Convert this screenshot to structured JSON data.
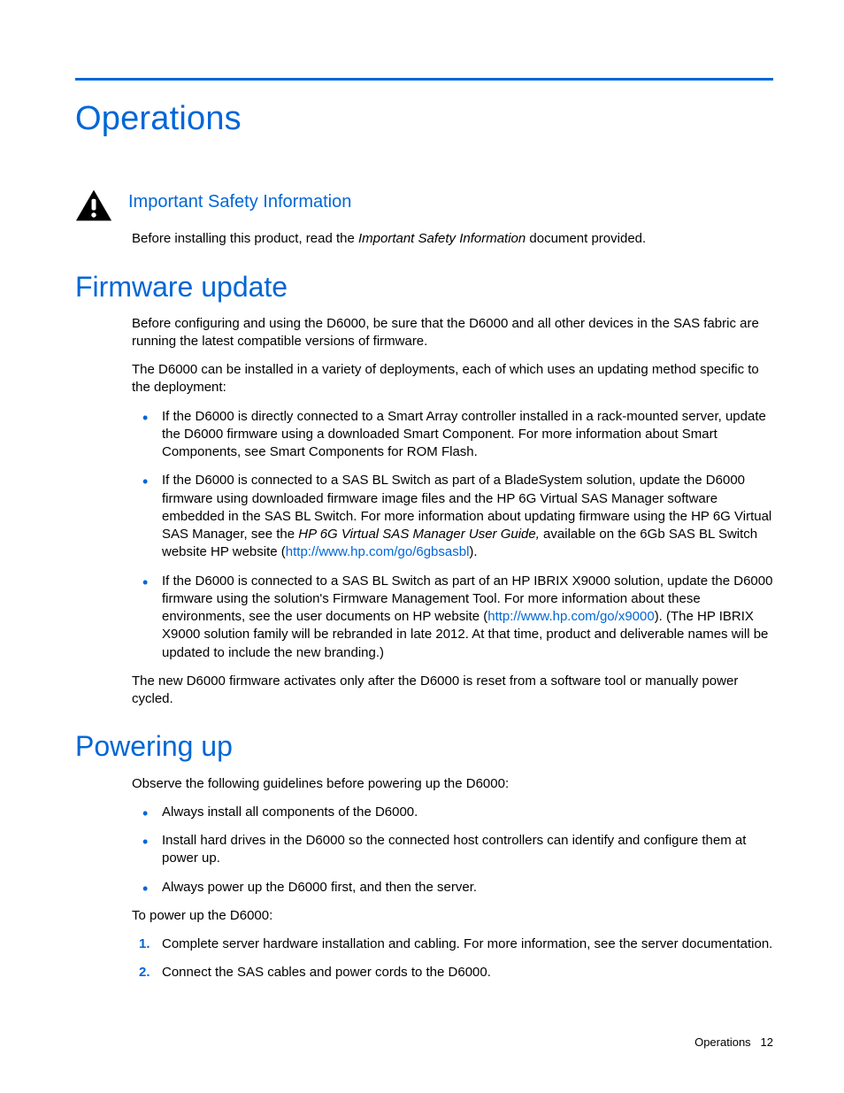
{
  "chapterTitle": "Operations",
  "safety": {
    "heading": "Important Safety Information",
    "p_before": "Before installing this product, read the ",
    "p_italic": "Important Safety Information",
    "p_after": " document provided."
  },
  "firmware": {
    "heading": "Firmware update",
    "p1": "Before configuring and using the D6000, be sure that the D6000 and all other devices in the SAS fabric are running the latest compatible versions of firmware.",
    "p2": "The D6000 can be installed in a variety of deployments, each of which uses an updating method specific to the deployment:",
    "b1": "If the D6000 is directly connected to a Smart Array controller installed in a rack-mounted server, update the D6000 firmware using a downloaded Smart Component. For more information about Smart Components, see Smart Components for ROM Flash.",
    "b2_pre": "If the D6000 is connected to a SAS BL Switch as part of a BladeSystem solution, update the D6000 firmware using downloaded firmware image files and the HP 6G Virtual SAS Manager software embedded in the SAS BL Switch. For more information about updating firmware using the HP 6G Virtual SAS Manager, see the ",
    "b2_italic": "HP 6G Virtual SAS Manager User Guide,",
    "b2_mid": " available on the 6Gb SAS BL Switch website HP website (",
    "b2_link": "http://www.hp.com/go/6gbsasbl",
    "b2_post": ").",
    "b3_pre": "If the D6000 is connected to a SAS BL Switch as part of an HP IBRIX X9000 solution, update the D6000 firmware using the solution's Firmware Management Tool. For more information about these environments, see the user documents on HP website (",
    "b3_link": "http://www.hp.com/go/x9000",
    "b3_post": "). (The HP IBRIX X9000 solution family will be rebranded in late 2012. At that time, product and deliverable names will be updated to include the new branding.)",
    "p3": "The new D6000 firmware activates only after the D6000 is reset from a software tool or manually power cycled."
  },
  "powering": {
    "heading": "Powering up",
    "p1": "Observe the following guidelines before powering up the D6000:",
    "b1": "Always install all components of the D6000.",
    "b2": "Install hard drives in the D6000 so the connected host controllers can identify and configure them at power up.",
    "b3": "Always power up the D6000 first, and then the server.",
    "p2": "To power up the D6000:",
    "n1": "Complete server hardware installation and cabling. For more information, see the server documentation.",
    "n2": "Connect the SAS cables and power cords to the D6000."
  },
  "footer": {
    "section": "Operations",
    "page": "12"
  }
}
